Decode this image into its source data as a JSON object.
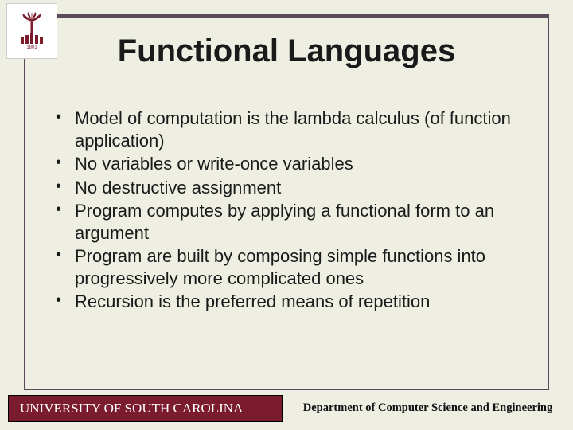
{
  "title": "Functional Languages",
  "bullets": [
    "Model of computation is the lambda calculus (of function application)",
    "No variables or write-once variables",
    "No destructive assignment",
    "Program computes by applying a functional form to an argument",
    "Program are built by composing simple functions into progressively more complicated ones",
    "Recursion is the preferred means of repetition"
  ],
  "footer": {
    "university": "UNIVERSITY OF SOUTH CAROLINA",
    "department": "Department of Computer Science and Engineering"
  },
  "logo": {
    "year": "1801"
  }
}
